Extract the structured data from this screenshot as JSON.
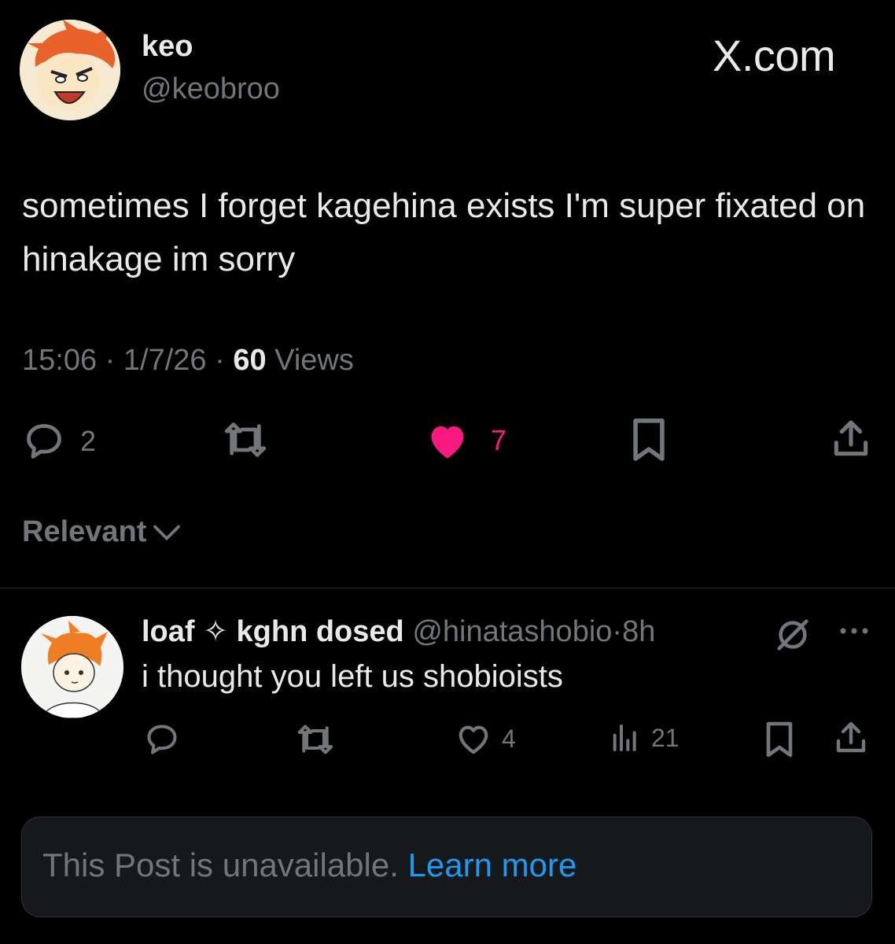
{
  "post": {
    "author_name": "keo",
    "author_handle": "@keobroo",
    "brand": "X.com",
    "text": "sometimes I forget kagehina exists I'm super fixated on hinakage im sorry",
    "time": "15:06",
    "date": "1/7/26",
    "views_count": "60",
    "views_label": "Views",
    "replies": "2",
    "likes": "7",
    "like_color": "#f91880",
    "liked": true
  },
  "sort": {
    "label": "Relevant"
  },
  "reply": {
    "name": "loaf ✧ kghn dosed",
    "handle": "@hinatashobio",
    "age": "8h",
    "text": "i thought you left us shobioists",
    "likes": "4",
    "views": "21"
  },
  "notice": {
    "text": "This Post is unavailable.",
    "link": "Learn more",
    "link_color": "#1d9bf0"
  }
}
